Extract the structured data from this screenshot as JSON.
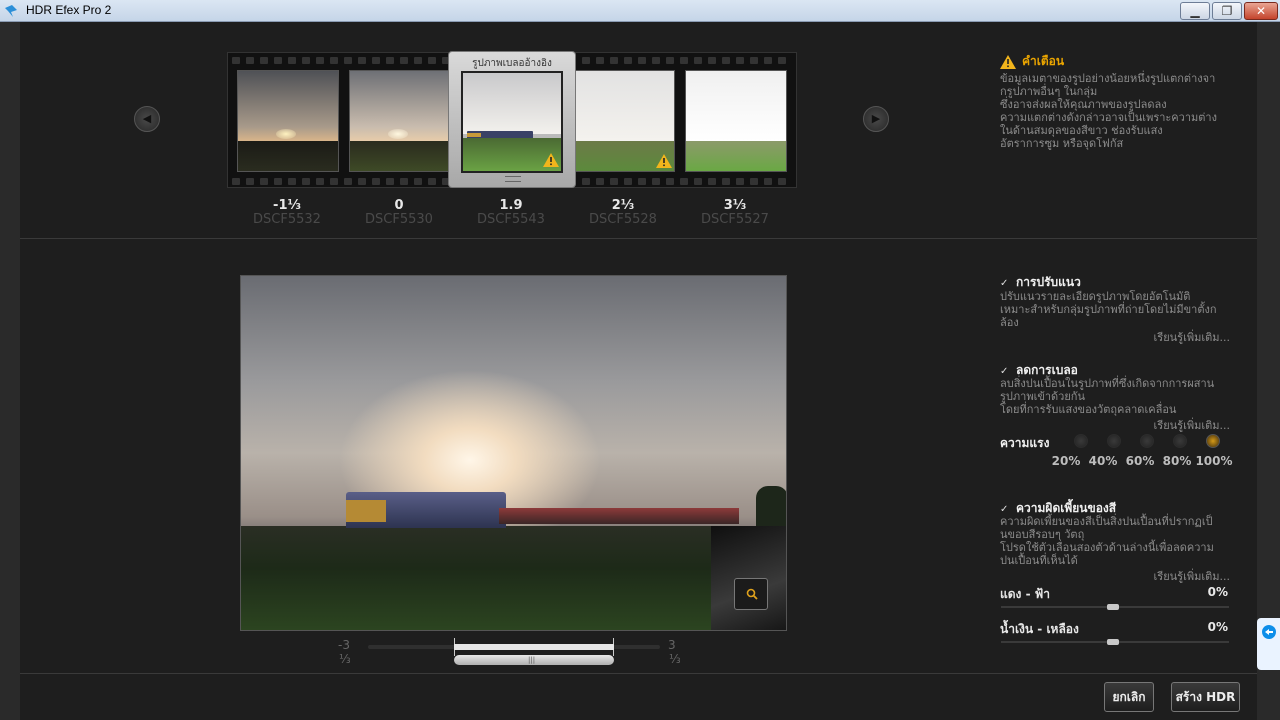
{
  "window": {
    "title": "HDR Efex Pro 2",
    "minimize": "▁",
    "maximize": "❐",
    "close": "✕"
  },
  "filmstrip": {
    "selected_label": "รูปภาพเบลออ้างอิง",
    "frames": [
      {
        "ev": "-1⅓",
        "file": "DSCF5532",
        "warning": false
      },
      {
        "ev": "0",
        "file": "DSCF5530",
        "warning": false
      },
      {
        "ev": "1.9",
        "file": "DSCF5543",
        "warning": true
      },
      {
        "ev": "2⅓",
        "file": "DSCF5528",
        "warning": true
      },
      {
        "ev": "3⅓",
        "file": "DSCF5527",
        "warning": false
      }
    ],
    "prev_icon": "arrow-left-icon",
    "next_icon": "arrow-right-icon"
  },
  "warning": {
    "title": "คำเตือน",
    "lines": [
      "ข้อมูลเมตาของรูปอย่างน้อยหนึ่งรูปแตกต่างจา",
      "กรูปภาพอื่นๆ ในกลุ่ม",
      "ซึ่งอาจส่งผลให้คุณภาพของรูปลดลง",
      "ความแตกต่างดังกล่าวอาจเป็นเพราะความต่าง",
      "ในด้านสมดุลของสีขาว ช่องรับแสง",
      "อัตราการซูม หรือจุดโฟกัส"
    ]
  },
  "exposure_slider": {
    "min_top": "-3",
    "min_bottom": "⅓",
    "max_top": "3",
    "max_bottom": "⅓"
  },
  "options": {
    "alignment": {
      "title": "การปรับแนว",
      "desc": [
        "ปรับแนวรายละเอียดรูปภาพโดยอัตโนมัติ",
        "เหมาะสำหรับกลุ่มรูปภาพที่ถ่ายโดยไม่มีขาตั้งก",
        "ล้อง"
      ],
      "learn_more": "เรียนรู้เพิ่มเติม..."
    },
    "ghost_reduction": {
      "title": "ลดการเบลอ",
      "desc": [
        "ลบสิ่งปนเปื้อนในรูปภาพที่ซึ่งเกิดจากการผสาน",
        "รูปภาพเข้าด้วยกัน",
        "โดยที่การรับแสงของวัตถุคลาดเคลื่อน"
      ],
      "learn_more": "เรียนรู้เพิ่มเติม...",
      "strength_label": "ความแรง",
      "levels": [
        "20%",
        "40%",
        "60%",
        "80%",
        "100%"
      ],
      "selected_level": "100%"
    },
    "chromatic": {
      "title": "ความผิดเพี้ยนของสี",
      "desc": [
        "ความผิดเพี้ยนของสีเป็นสิ่งปนเปื้อนที่ปรากฏเป็",
        "นขอบสีรอบๆ วัตถุ",
        "โปรดใช้ตัวเลื่อนสองตัวด้านล่างนี้เพื่อลดความ",
        "ปนเปื้อนที่เห็นได้"
      ],
      "learn_more": "เรียนรู้เพิ่มเติม...",
      "red_cyan_label": "แดง - ฟ้า",
      "red_cyan_value": "0%",
      "blue_yellow_label": "น้ำเงิน - เหลือง",
      "blue_yellow_value": "0%"
    }
  },
  "buttons": {
    "cancel": "ยกเลิก",
    "create": "สร้าง HDR"
  },
  "colors": {
    "warning": "#e9a400",
    "background": "#1e1e1e"
  }
}
